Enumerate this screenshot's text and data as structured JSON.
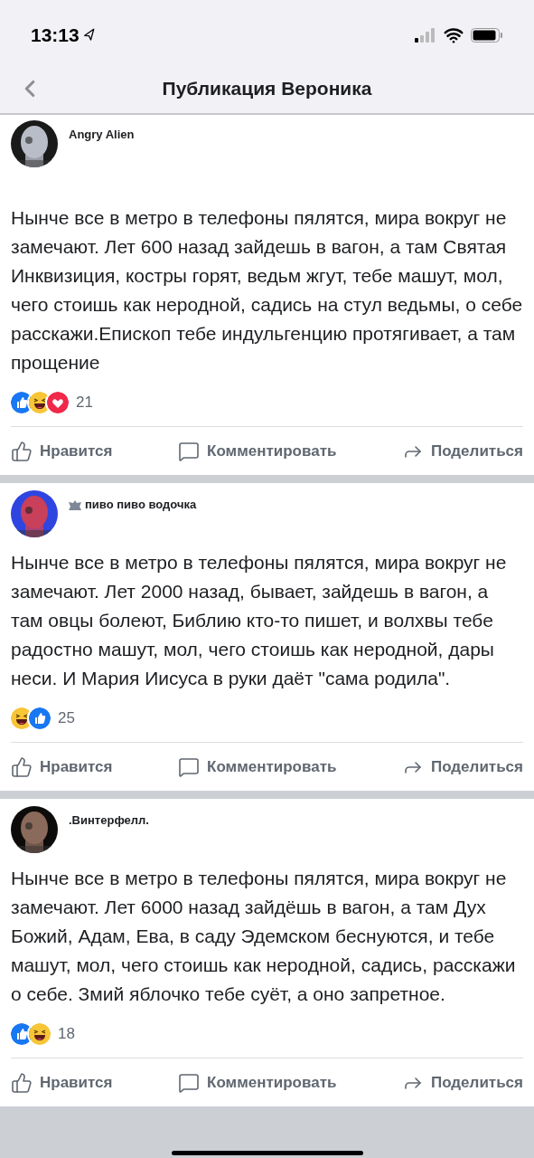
{
  "status_bar": {
    "time": "13:13"
  },
  "nav": {
    "title": "Публикация Вероника"
  },
  "posts": [
    {
      "author": "Angry Alien",
      "badge": false,
      "avatar": {
        "kind": "picture"
      },
      "text": "Нынче все в метро в телефоны пялятся, мира вокруг не замечают. Лет 600 назад зайдешь в вагон, а там Святая Инквизиция, костры горят, ведьм жгут, тебе машут, мол, чего стоишь как неродной, садись на стул ведьмы, о себе расскажи.Епископ тебе индульгенцию протягивает, а там прощение",
      "reactions": [
        {
          "kind": "like"
        },
        {
          "kind": "haha"
        },
        {
          "kind": "love"
        }
      ],
      "count": "21",
      "actions": [
        "Нравится",
        "Комментировать",
        "Поделиться"
      ]
    },
    {
      "author": "пиво пиво водочка",
      "badge": true,
      "avatar": {
        "kind": "picture"
      },
      "text": "Нынче все в метро в телефоны пялятся, мира вокруг не замечают. Лет 2000 назад, бывает, зайдешь в вагон, а там овцы болеют, Библию кто-то пишет, и волхвы тебе радостно машут, мол, чего стоишь как неродной, дары неси. И Мария Иисуса в руки даёт \"сама родила\".",
      "reactions": [
        {
          "kind": "haha"
        },
        {
          "kind": "like"
        }
      ],
      "count": "25",
      "actions": [
        "Нравится",
        "Комментировать",
        "Поделиться"
      ]
    },
    {
      "author": ".Винтерфелл.",
      "badge": false,
      "avatar": {
        "kind": "picture"
      },
      "text": "Нынче все в метро в телефоны пялятся, мира вокруг не замечают. Лет 6000 назад зайдёшь в вагон, а там Дух Божий, Адам, Ева, в саду Эдемском беснуются, и тебе машут, мол, чего стоишь как неродной, садись, расскажи о себе. Змий яблочко тебе суёт, а оно запретное.",
      "reactions": [
        {
          "kind": "like"
        },
        {
          "kind": "haha"
        }
      ],
      "count": "18",
      "actions": [
        "Нравится",
        "Комментировать",
        "Поделиться"
      ]
    }
  ]
}
